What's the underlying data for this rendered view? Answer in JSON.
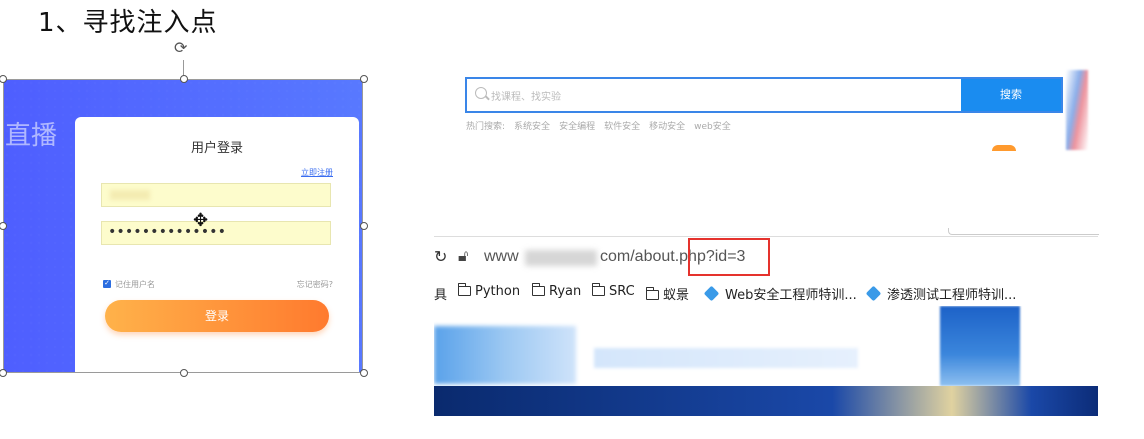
{
  "slide": {
    "title": "1、寻找注入点"
  },
  "login": {
    "live_text": "直播",
    "title": "用户登录",
    "register_link": "立即注册",
    "password_value": "••••••••••••••",
    "remember_label": "记住用户名",
    "forgot_link": "忘记密码?",
    "login_button": "登录"
  },
  "search": {
    "placeholder": "找课程、找实验",
    "button": "搜索",
    "hot_label": "热门搜索:",
    "hot_items": [
      "系统安全",
      "安全编程",
      "软件安全",
      "移动安全",
      "web安全"
    ]
  },
  "browser": {
    "url_prefix": "www",
    "url_suffix": "com/about.php?id=3",
    "bookmarks": [
      {
        "icon": "folder-icon",
        "label": "具"
      },
      {
        "icon": "folder-icon",
        "label": "Python"
      },
      {
        "icon": "folder-icon",
        "label": "Ryan"
      },
      {
        "icon": "folder-icon",
        "label": "SRC"
      },
      {
        "icon": "folder-icon",
        "label": "蚁景"
      },
      {
        "icon": "diamond-icon",
        "label": "Web安全工程师特训..."
      },
      {
        "icon": "diamond-icon",
        "label": "渗透测试工程师特训..."
      }
    ]
  },
  "colors": {
    "login_bg": "#4b6bff",
    "search_accent": "#1a8cf0",
    "highlight": "#e5322d",
    "login_button": "#ff7a2e"
  }
}
